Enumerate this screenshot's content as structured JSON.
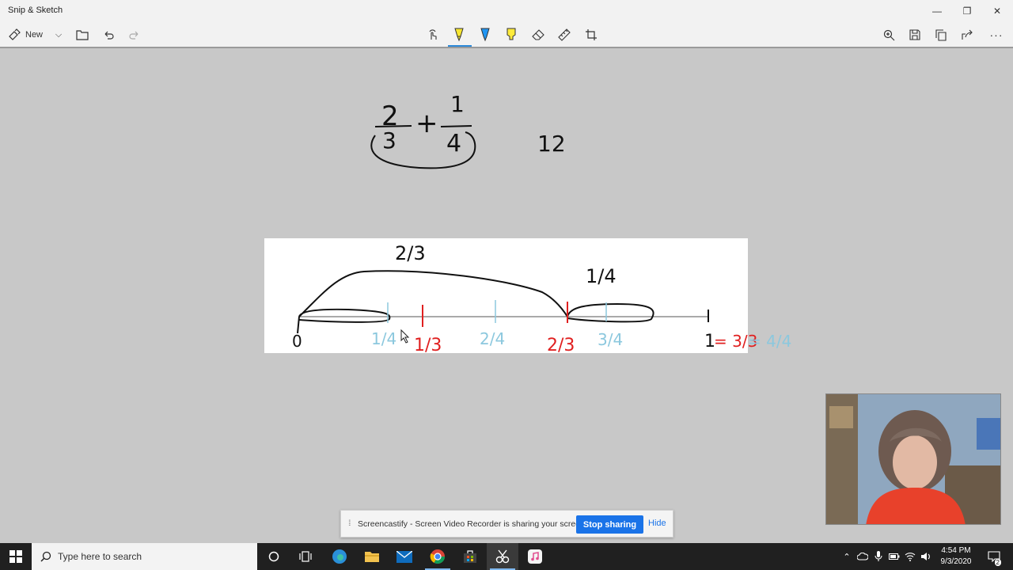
{
  "window": {
    "title": "Snip & Sketch",
    "minimize": "—",
    "restore": "❐",
    "close": "✕"
  },
  "toolbar": {
    "new_label": "New",
    "new_chevron": "⌵",
    "icons": [
      "new-icon",
      "open-folder-icon",
      "undo-icon",
      "redo-icon",
      "touch-writing-icon",
      "ballpoint-pen-icon",
      "pencil-icon",
      "highlighter-icon",
      "eraser-icon",
      "ruler-icon",
      "crop-icon",
      "zoom-icon",
      "save-icon",
      "copy-icon",
      "share-icon",
      "more-icon"
    ],
    "more_label": "···",
    "selected_tool": "ballpoint-pen",
    "pen_colors": {
      "ballpoint": "#1a1a1a",
      "pencil": "#2196f3",
      "highlighter": "#ffeb3b"
    }
  },
  "canvas": {
    "top_problem": {
      "numerator_left": "2",
      "denominator_left": "3",
      "operator": "+",
      "numerator_right": "1",
      "denominator_right": "4",
      "side_note": "12"
    },
    "number_line": {
      "jump_top_label": "2/3",
      "jump_right_label": "1/4",
      "zero_label": "0",
      "quarter_labels": [
        "1/4",
        "2/4",
        "3/4"
      ],
      "third_labels": [
        "1/3",
        "2/3"
      ],
      "end_label_black": "1",
      "end_label_red": "= 3/3",
      "end_label_blue": "= 4/4"
    },
    "ink_colors": {
      "black": "#111111",
      "red": "#e02020",
      "blue": "#8cc8de"
    }
  },
  "screencastify": {
    "grip": "⁞⁞",
    "message": "Screencastify - Screen Video Recorder is sharing your screen.",
    "stop_label": "Stop sharing",
    "hide_label": "Hide"
  },
  "taskbar": {
    "search_placeholder": "Type here to search",
    "time": "4:54 PM",
    "date": "9/3/2020",
    "notification_count": "2",
    "tray_chevron": "⌃"
  }
}
